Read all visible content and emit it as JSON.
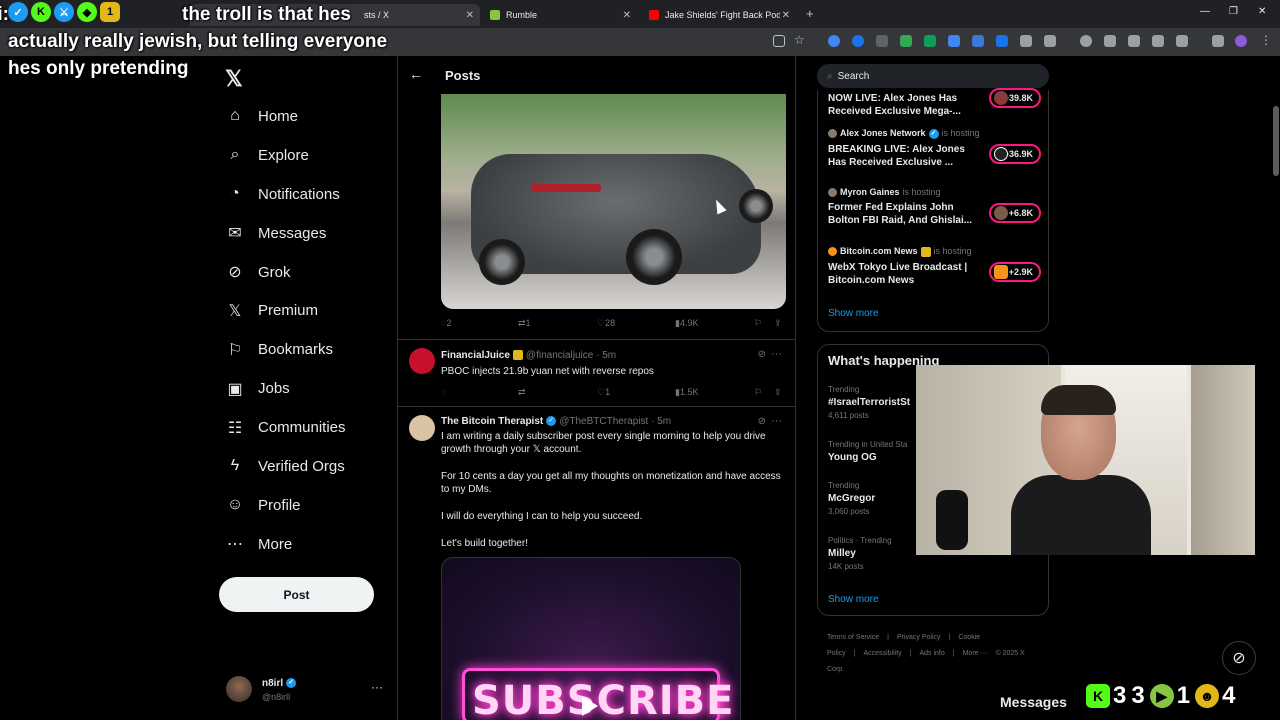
{
  "browser": {
    "tabs": [
      {
        "label": "sts / X",
        "color": "#000000"
      },
      {
        "label": "Rumble",
        "color": "#85c742"
      },
      {
        "label": "Jake Shields' Fight Back Podcast",
        "color": "#ff0000"
      }
    ],
    "window_controls": [
      "—",
      "❐",
      "✕"
    ]
  },
  "overlay": {
    "username": "Alti:",
    "message": "the troll is that hes actually really jewish, but telling everyone hes only pretending",
    "badge_icons": [
      "verified-badge-icon",
      "kick-badge-icon",
      "sword-icon",
      "gem-icon",
      "number-one-icon"
    ]
  },
  "nav": {
    "logo": "𝕏",
    "items": [
      {
        "label": "Home",
        "icon": "home-icon",
        "glyph": "⌂"
      },
      {
        "label": "Explore",
        "icon": "search-icon",
        "glyph": "⌕"
      },
      {
        "label": "Notifications",
        "icon": "bell-icon",
        "glyph": "◔"
      },
      {
        "label": "Messages",
        "icon": "envelope-icon",
        "glyph": "✉"
      },
      {
        "label": "Grok",
        "icon": "grok-icon",
        "glyph": "⊘"
      },
      {
        "label": "Premium",
        "icon": "x-premium-icon",
        "glyph": "𝕏"
      },
      {
        "label": "Bookmarks",
        "icon": "bookmark-icon",
        "glyph": "⚐"
      },
      {
        "label": "Jobs",
        "icon": "briefcase-icon",
        "glyph": "▣"
      },
      {
        "label": "Communities",
        "icon": "people-icon",
        "glyph": "☷"
      },
      {
        "label": "Verified Orgs",
        "icon": "lightning-icon",
        "glyph": "ϟ"
      },
      {
        "label": "Profile",
        "icon": "person-icon",
        "glyph": "☺"
      },
      {
        "label": "More",
        "icon": "more-circle-icon",
        "glyph": "⋯"
      }
    ],
    "post_button": "Post",
    "account": {
      "name": "n8irl",
      "handle": "@n8irll",
      "more": "···"
    }
  },
  "main": {
    "title": "Posts",
    "first_post_actions": {
      "replies": "2",
      "reposts": "1",
      "likes": "28",
      "views": "4.9K"
    },
    "tweets": [
      {
        "name": "FinancialJuice",
        "handle": "@financialjuice · 5m",
        "text": "PBOC injects 21.9b yuan net with reverse repos",
        "replies": "",
        "reposts": "",
        "likes": "1",
        "views": "1.5K",
        "avatar_color": "#c8102e"
      },
      {
        "name": "The Bitcoin Therapist",
        "handle": "@TheBTCTherapist · 5m",
        "paragraphs": [
          "I am writing a daily subscriber post every single morning to help you drive growth through your 𝕏 account.",
          "For 10 cents a day you get all my thoughts on monetization and have access to my DMs.",
          "I will do everything I can to help you succeed.",
          "Let's build together!"
        ],
        "image_text": "SUBSCRIBE",
        "avatar_color": "#d9c3a5"
      }
    ]
  },
  "right": {
    "search_placeholder": "Search",
    "live": [
      {
        "host": "",
        "title": "NOW LIVE: Alex Jones Has Received Exclusive Mega-...",
        "count": "+39.8K"
      },
      {
        "host": "Alex Jones Network",
        "hosting": "is hosting",
        "title": "BREAKING LIVE: Alex Jones Has Received Exclusive ...",
        "count": "+36.9K"
      },
      {
        "host": "Myron Gaines",
        "hosting": "is hosting",
        "title": "Former Fed Explains John Bolton FBI Raid, And Ghislai...",
        "count": "+6.8K"
      },
      {
        "host": "Bitcoin.com News",
        "hosting": "is hosting",
        "title": "WebX Tokyo Live Broadcast | Bitcoin.com News",
        "count": "+2.9K"
      }
    ],
    "show_more": "Show more",
    "happening_title": "What's happening",
    "trends": [
      {
        "context": "Trending",
        "title": "#IsraelTerroristSt",
        "posts": "4,611 posts"
      },
      {
        "context": "Trending in United Sta",
        "title": "Young OG",
        "posts": ""
      },
      {
        "context": "Trending",
        "title": "McGregor",
        "posts": "3,060 posts"
      },
      {
        "context": "Politics · Trending",
        "title": "Milley",
        "posts": "14K posts"
      }
    ],
    "show_more_2": "Show more",
    "footer": [
      "Terms of Service",
      "|",
      "Privacy Policy",
      "|",
      "Cookie Policy",
      "|",
      "Accessibility",
      "|",
      "Ads info",
      "|",
      "More ···",
      "© 2025 X Corp."
    ]
  },
  "dock": {
    "messages": "Messages",
    "kick_count": "3",
    "kick_count2": "3",
    "rumble_count": "1",
    "other_count": "4"
  }
}
